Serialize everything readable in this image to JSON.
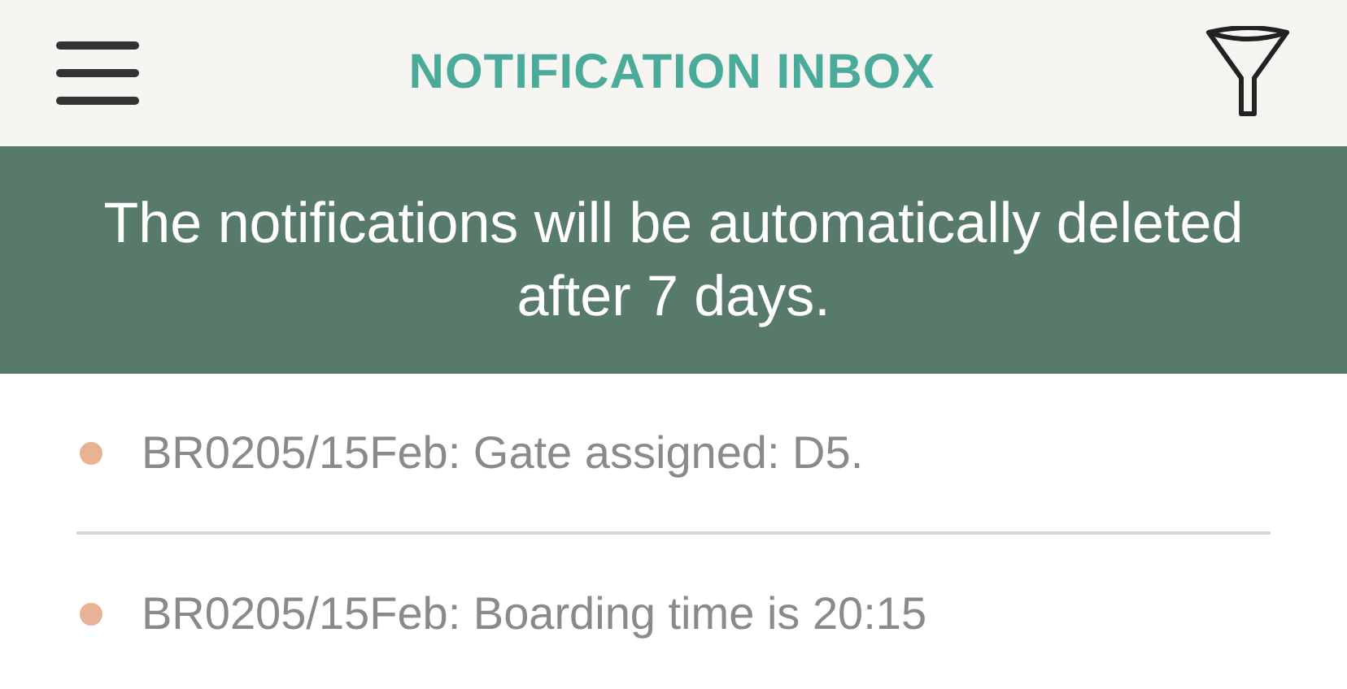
{
  "header": {
    "title": "NOTIFICATION INBOX"
  },
  "banner": {
    "text": "The notifications will be automatically deleted after 7 days."
  },
  "notifications": [
    {
      "text": "BR0205/15Feb: Gate assigned: D5.",
      "unread": true
    },
    {
      "text": "BR0205/15Feb: Boarding time is 20:15",
      "unread": true
    }
  ]
}
